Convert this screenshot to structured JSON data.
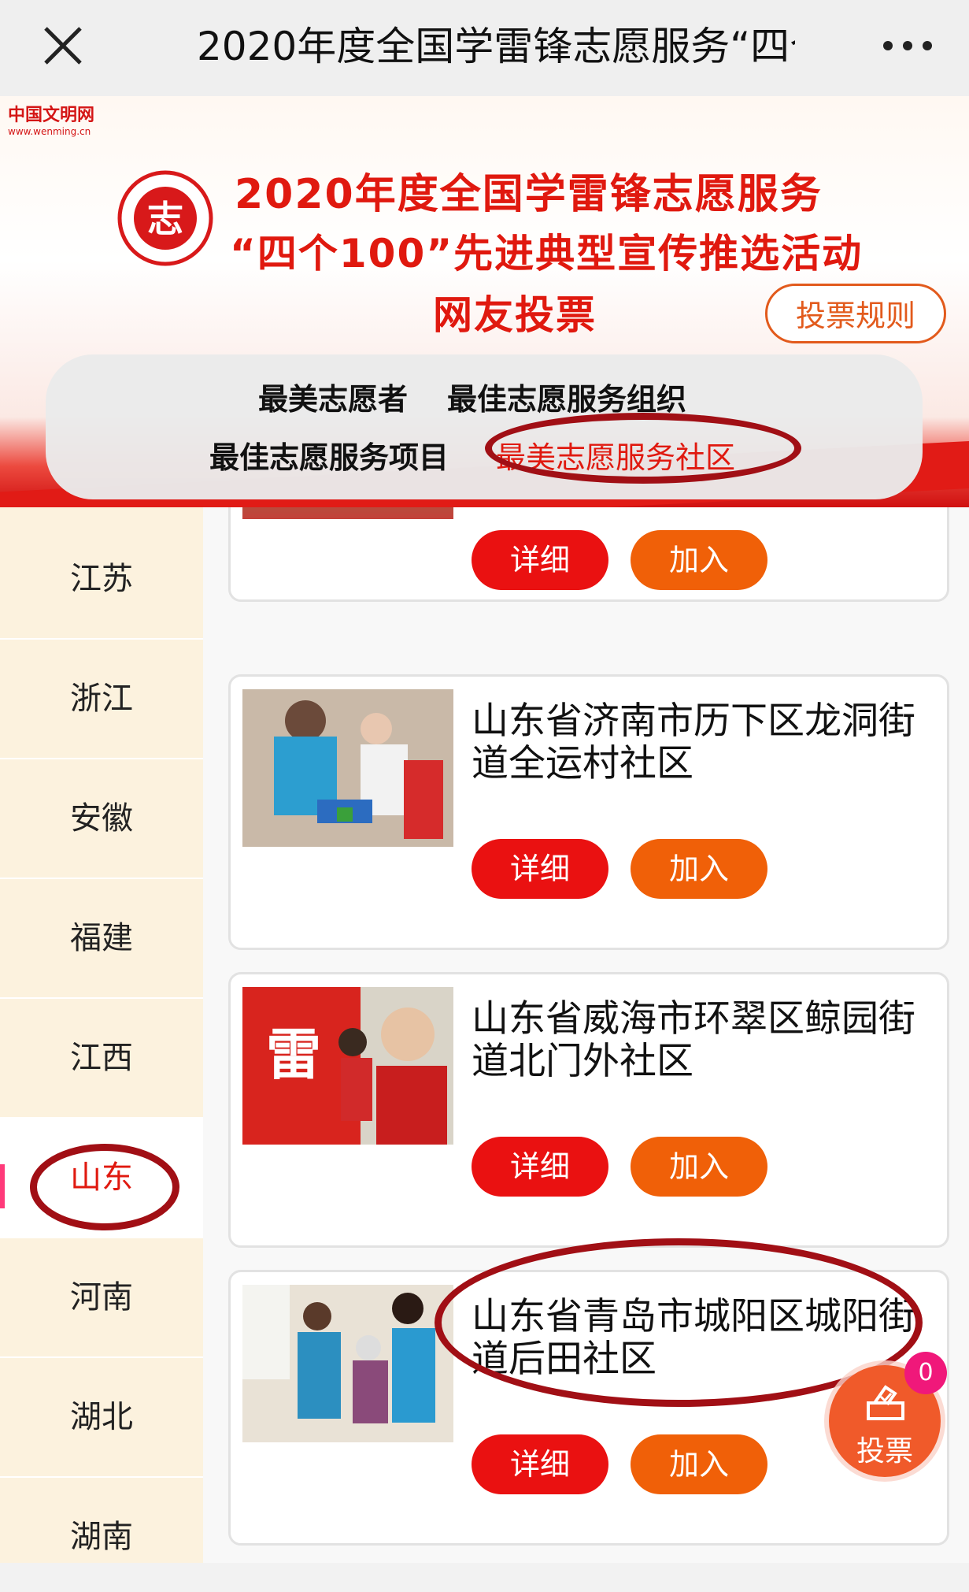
{
  "window": {
    "title": "2020年度全国学雷锋志愿服务“四个100”先进典型宣传推选活动"
  },
  "banner": {
    "brand_cn": "中国文明网",
    "brand_en": "www.wenming.cn",
    "emblem_char": "志",
    "line1": "2020年度全国学雷锋志愿服务",
    "line2": "“四个100”先进典型宣传推选活动",
    "line3": "网友投票",
    "rules_label": "投票规则"
  },
  "categories": [
    "最美志愿者",
    "最佳志愿服务组织",
    "最佳志愿服务项目",
    "最美志愿服务社区"
  ],
  "active_category": "最美志愿服务社区",
  "provinces": [
    "江苏",
    "浙江",
    "安徽",
    "福建",
    "江西",
    "山东",
    "河南",
    "湖北",
    "湖南"
  ],
  "active_province": "山东",
  "cards": [
    {
      "name": "",
      "detail": "详细",
      "join": "加入"
    },
    {
      "name": "山东省济南市历下区龙洞街道全运村社区",
      "detail": "详细",
      "join": "加入"
    },
    {
      "name": "山东省威海市环翠区鲸园街道北门外社区",
      "detail": "详细",
      "join": "加入"
    },
    {
      "name": "山东省青岛市城阳区城阳街道后田社区",
      "detail": "详细",
      "join": "加入"
    }
  ],
  "vote": {
    "label": "投票",
    "count": "0"
  },
  "colors": {
    "accent": "#e0190f",
    "join": "#f06008",
    "annotation": "#a10f15"
  }
}
